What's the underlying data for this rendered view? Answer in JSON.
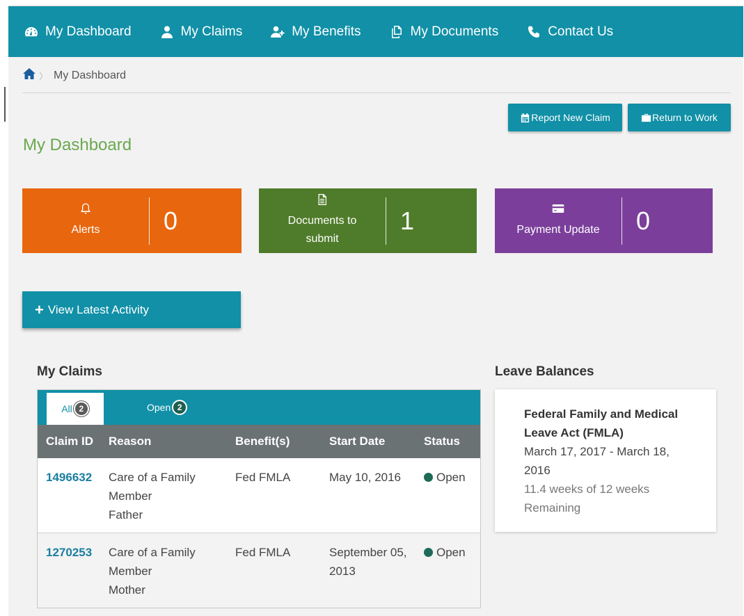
{
  "nav": {
    "items": [
      {
        "label": "My Dashboard",
        "icon": "dashboard-icon"
      },
      {
        "label": "My Claims",
        "icon": "user-icon"
      },
      {
        "label": "My Benefits",
        "icon": "user-plus-icon"
      },
      {
        "label": "My Documents",
        "icon": "documents-icon"
      },
      {
        "label": "Contact Us",
        "icon": "phone-icon"
      }
    ]
  },
  "breadcrumb": {
    "current": "My Dashboard"
  },
  "actions": {
    "report_label": "Report New Claim",
    "return_label": "Return to Work"
  },
  "page": {
    "title": "My Dashboard"
  },
  "tiles": {
    "alerts": {
      "label": "Alerts",
      "count": "0",
      "color": "#e8660e"
    },
    "documents": {
      "label_line1": "Documents to",
      "label_line2": "submit",
      "count": "1",
      "color": "#4f7c2a"
    },
    "payment": {
      "label": "Payment Update",
      "count": "0",
      "color": "#7b3f9b"
    }
  },
  "activity": {
    "label": "View Latest Activity"
  },
  "claims": {
    "title": "My Claims",
    "tabs": {
      "all_label": "All",
      "all_count": "2",
      "open_label": "Open",
      "open_count": "2"
    },
    "columns": {
      "claim_id": "Claim ID",
      "reason": "Reason",
      "benefits": "Benefit(s)",
      "start_date": "Start Date",
      "status": "Status"
    },
    "rows": [
      {
        "claim_id": "1496632",
        "reason_line1": "Care of a Family",
        "reason_line2": "Member",
        "reason_line3": "Father",
        "benefit": "Fed FMLA",
        "start_line1": "May 10, 2016",
        "start_line2": "",
        "status": "Open"
      },
      {
        "claim_id": "1270253",
        "reason_line1": "Care of a Family",
        "reason_line2": "Member",
        "reason_line3": "Mother",
        "benefit": "Fed FMLA",
        "start_line1": "September 05,",
        "start_line2": "2013",
        "status": "Open"
      }
    ]
  },
  "leave": {
    "title": "Leave Balances",
    "card": {
      "name_line1": "Federal Family and Medical",
      "name_line2": "Leave Act (FMLA)",
      "dates_line1": "March 17, 2017 - March 18,",
      "dates_line2": "2016",
      "remaining_line1": "11.4 weeks of 12 weeks",
      "remaining_line2": "Remaining"
    }
  },
  "colors": {
    "primary": "#1190a7",
    "title_green": "#6ba84f",
    "status_open": "#1d6b56"
  }
}
